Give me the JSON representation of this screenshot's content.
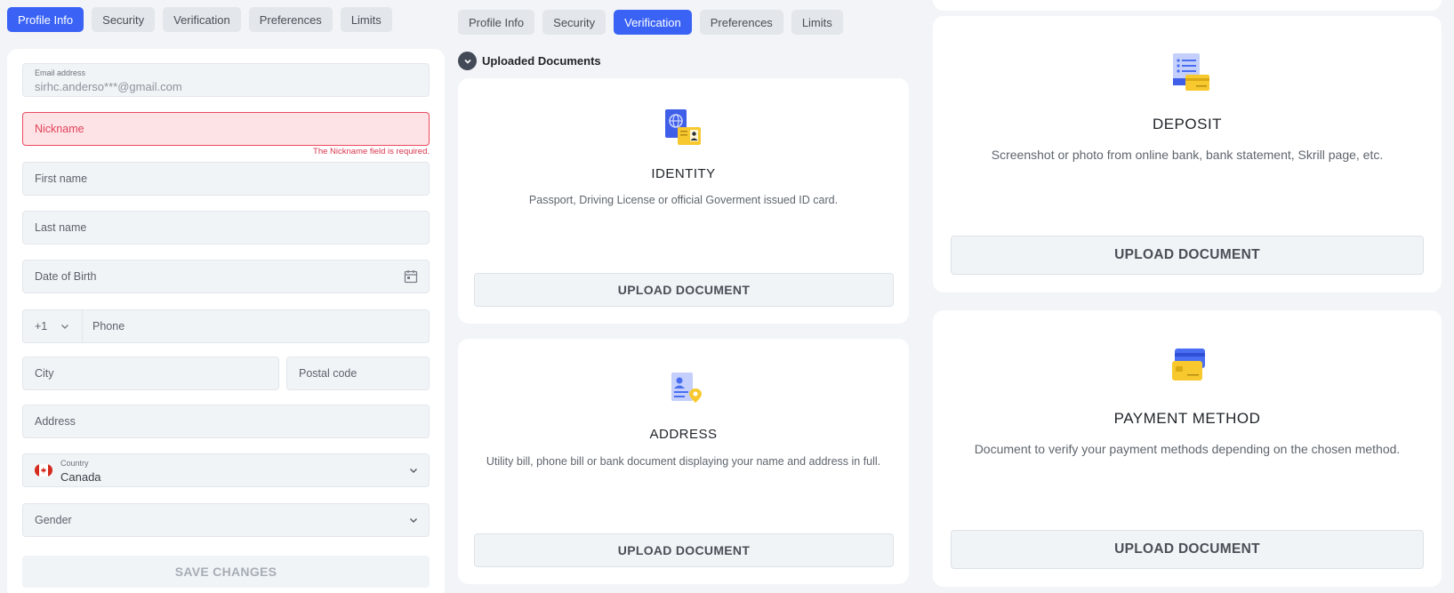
{
  "left": {
    "tabs": [
      "Profile Info",
      "Security",
      "Verification",
      "Preferences",
      "Limits"
    ],
    "active_tab": "Profile Info",
    "email": {
      "label": "Email address",
      "value": "sirhc.anderso***@gmail.com"
    },
    "nickname": {
      "placeholder": "Nickname",
      "error": "The Nickname field is required."
    },
    "first_name": "First name",
    "last_name": "Last name",
    "dob": "Date of Birth",
    "phone_code": "+1",
    "phone": "Phone",
    "city": "City",
    "postal": "Postal code",
    "address": "Address",
    "country": {
      "label": "Country",
      "value": "Canada"
    },
    "gender": "Gender",
    "save": "SAVE CHANGES"
  },
  "middle": {
    "tabs": [
      "Profile Info",
      "Security",
      "Verification",
      "Preferences",
      "Limits"
    ],
    "active_tab": "Verification",
    "section_title": "Uploaded Documents",
    "cards": [
      {
        "title": "IDENTITY",
        "desc": "Passport, Driving License or official Goverment issued ID card.",
        "button": "UPLOAD DOCUMENT",
        "icon": "passport-icon"
      },
      {
        "title": "ADDRESS",
        "desc": "Utility bill, phone bill or bank document displaying your name and address in full.",
        "button": "UPLOAD DOCUMENT",
        "icon": "address-document-icon"
      }
    ]
  },
  "right": {
    "cards": [
      {
        "title": "DEPOSIT",
        "desc": "Screenshot or photo from online bank, bank statement, Skrill page, etc.",
        "button": "UPLOAD DOCUMENT",
        "icon": "deposit-statement-icon"
      },
      {
        "title": "PAYMENT METHOD",
        "desc": "Document to verify your payment methods depending on the chosen method.",
        "button": "UPLOAD DOCUMENT",
        "icon": "credit-card-icon"
      }
    ]
  },
  "colors": {
    "accent": "#3a63f5",
    "error": "#e0435a",
    "icon_blue": "#4a6ef2",
    "icon_yellow": "#f7c92e"
  }
}
